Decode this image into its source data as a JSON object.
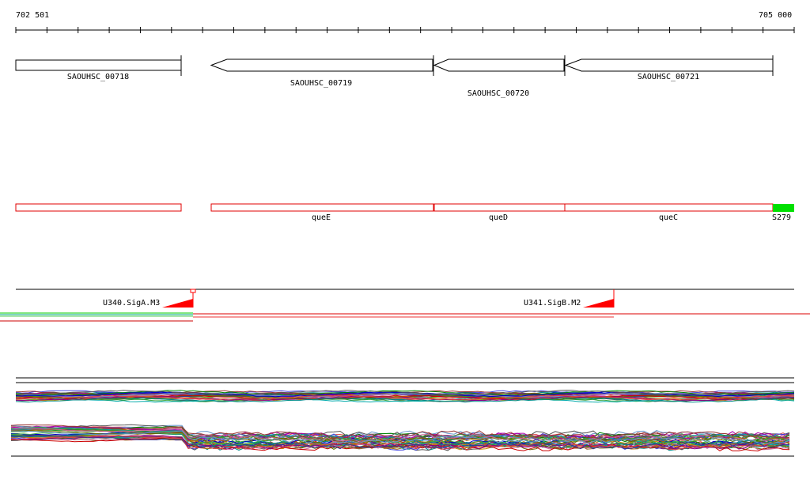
{
  "ruler": {
    "start_label": "702 501",
    "end_label": "705 000",
    "start": 702501,
    "end": 705000
  },
  "genes": [
    {
      "name": "SAOUHSC_00718",
      "strand": "+"
    },
    {
      "name": "SAOUHSC_00719",
      "strand": "-"
    },
    {
      "name": "SAOUHSC_00720",
      "strand": "-"
    },
    {
      "name": "SAOUHSC_00721",
      "strand": "-"
    }
  ],
  "features": [
    {
      "name": "",
      "color": "#e00000"
    },
    {
      "name": "queE",
      "color": "#e00000"
    },
    {
      "name": "queD",
      "color": "#e00000"
    },
    {
      "name": "queC",
      "color": "#e00000"
    },
    {
      "name": "S279",
      "color": "#00e000"
    }
  ],
  "promoters": [
    {
      "name": "U340.SigA.M3",
      "color": "#ff0000"
    },
    {
      "name": "U341.SigB.M2",
      "color": "#ff0000"
    }
  ],
  "colors": {
    "gene_outline": "#000000",
    "feature_outline": "#e00000",
    "promoter": "#ff0000",
    "green_track": "#00cc00"
  }
}
